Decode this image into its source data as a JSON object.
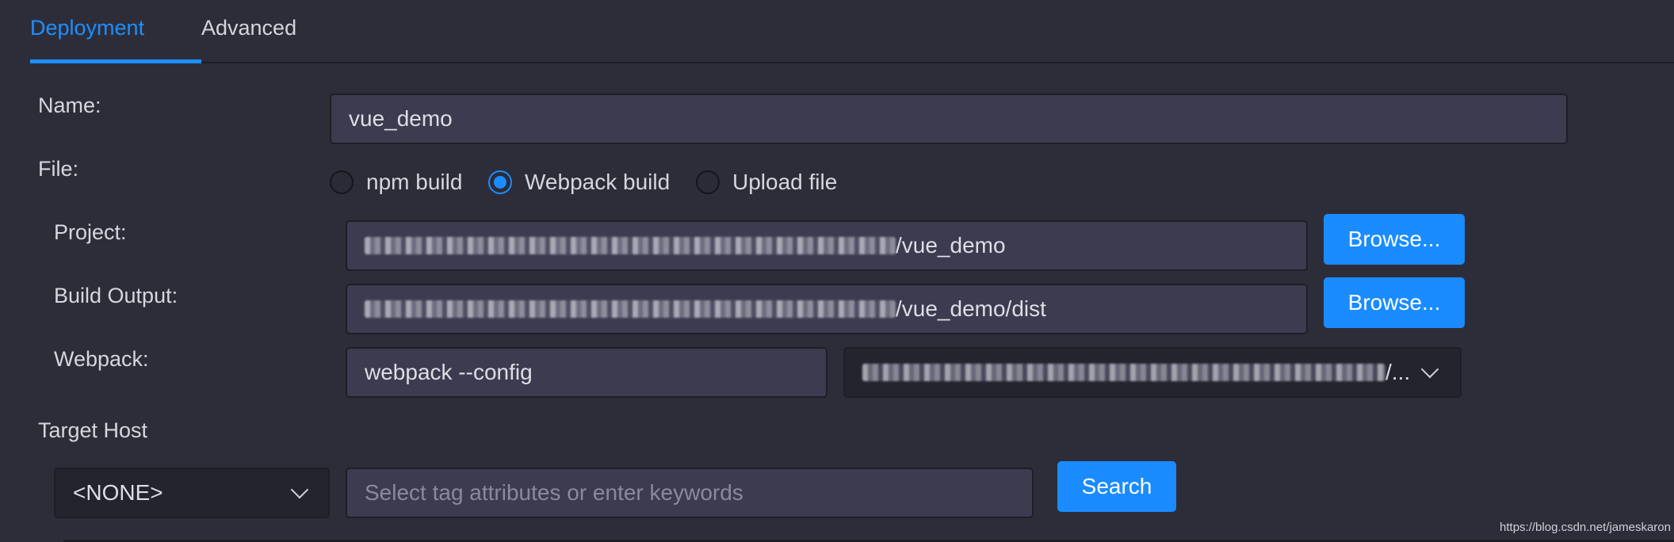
{
  "tabs": [
    {
      "label": "Deployment",
      "active": true
    },
    {
      "label": "Advanced",
      "active": false
    }
  ],
  "form": {
    "name_label": "Name:",
    "name_value": "vue_demo",
    "file_label": "File:",
    "file_options": [
      {
        "label": "npm build",
        "selected": false
      },
      {
        "label": "Webpack build",
        "selected": true
      },
      {
        "label": "Upload file",
        "selected": false
      }
    ],
    "project_label": "Project:",
    "project_value_visible": "/vue_demo",
    "build_output_label": "Build Output:",
    "build_output_value_visible": "/vue_demo/dist",
    "browse_label": "Browse...",
    "webpack_label": "Webpack:",
    "webpack_command": "webpack --config",
    "webpack_config_visible": "/...",
    "target_host_label": "Target Host",
    "host_select_value": "<NONE>",
    "search_placeholder": "Select tag attributes or enter keywords",
    "search_button": "Search"
  },
  "icons": {
    "dropdown": "chevron-down-icon",
    "radio": "radio-icon"
  },
  "colors": {
    "accent": "#1a8cff",
    "background": "#2d2d3a",
    "input_bg": "#3c3b4f"
  },
  "watermark": "https://blog.csdn.net/jameskaron"
}
